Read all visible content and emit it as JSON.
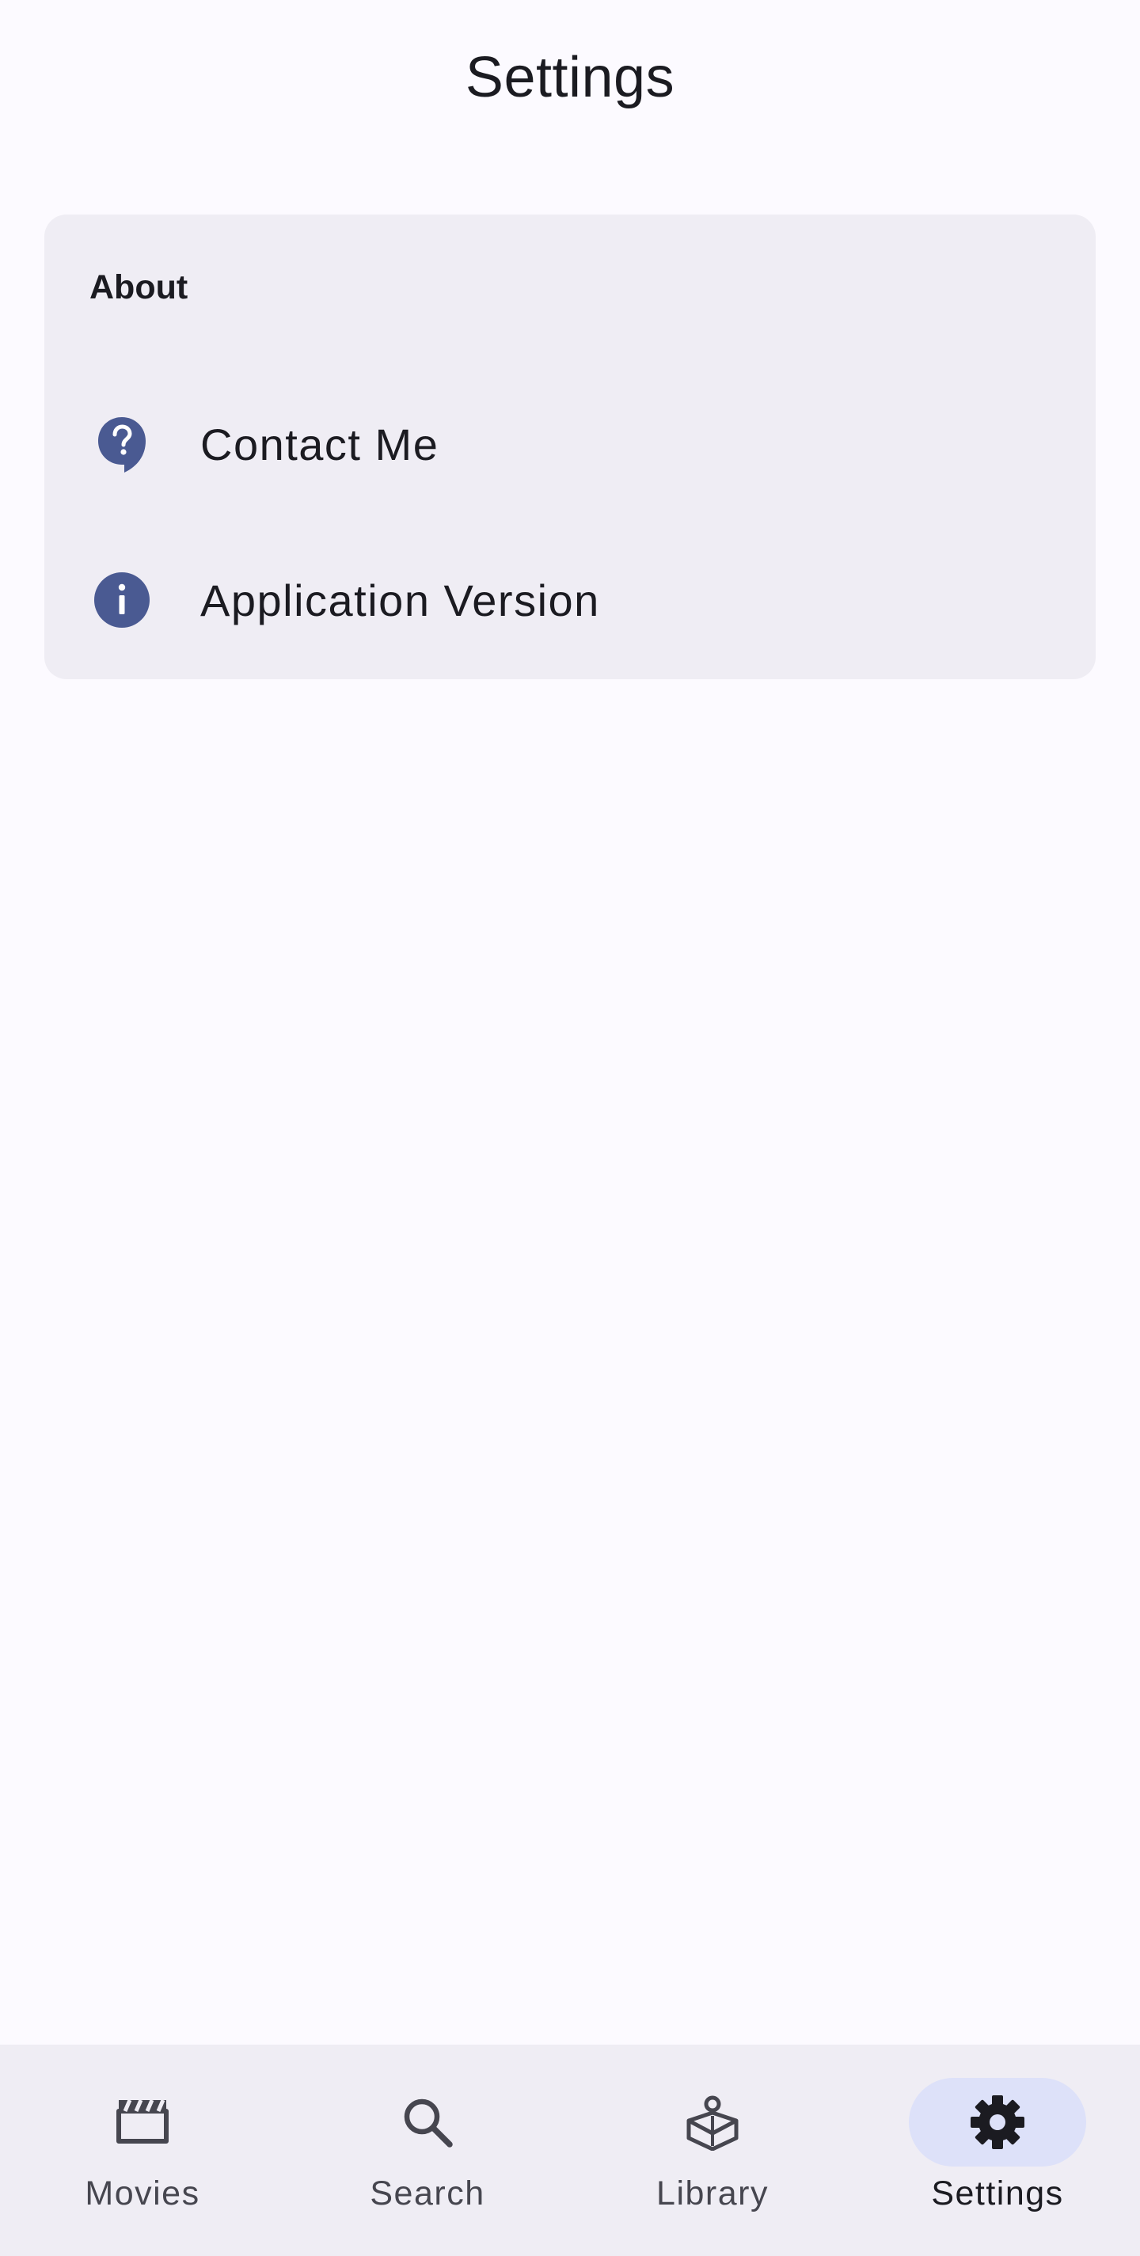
{
  "header": {
    "title": "Settings"
  },
  "about_card": {
    "section_title": "About",
    "items": [
      {
        "label": "Contact Me",
        "icon": "help-bubble-icon"
      },
      {
        "label": "Application Version",
        "icon": "info-icon"
      }
    ]
  },
  "bottom_nav": {
    "items": [
      {
        "label": "Movies",
        "icon": "clapperboard-icon",
        "active": false
      },
      {
        "label": "Search",
        "icon": "search-icon",
        "active": false
      },
      {
        "label": "Library",
        "icon": "library-reader-icon",
        "active": false
      },
      {
        "label": "Settings",
        "icon": "gear-icon",
        "active": true
      }
    ],
    "active_indicator_color": "#dde1f9"
  },
  "colors": {
    "background": "#fcfaff",
    "card": "#efedf4",
    "accent_icon": "#4a5a92",
    "text": "#1b1b21",
    "nav_text": "#46464f"
  }
}
